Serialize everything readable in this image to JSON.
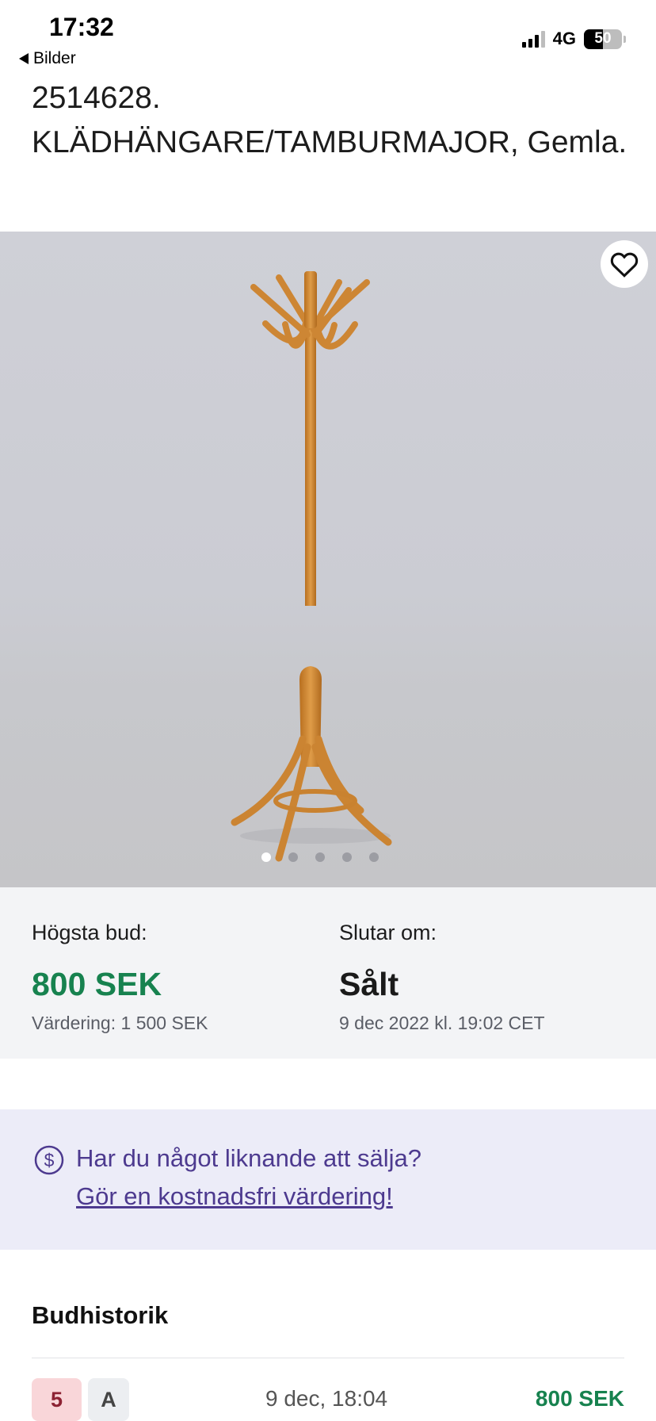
{
  "status_bar": {
    "time": "17:32",
    "back_label": "Bilder",
    "network": "4G",
    "battery": "50"
  },
  "listing": {
    "title": "2514628. KLÄDHÄNGARE/TAMBURMAJOR, Gemla."
  },
  "gallery": {
    "image_count": 5,
    "active_index": 0,
    "favorite_icon": "heart-icon"
  },
  "bidding": {
    "highest_bid_label": "Högsta bud:",
    "highest_bid_value": "800 SEK",
    "valuation": "Värdering: 1 500 SEK",
    "ends_label": "Slutar om:",
    "ends_value": "Sålt",
    "end_date": "9 dec 2022 kl. 19:02 CET"
  },
  "promo": {
    "icon": "dollar-circle-icon",
    "question": "Har du något liknande att sälja?",
    "link": "Gör en kostnadsfri värdering!"
  },
  "history": {
    "title": "Budhistorik",
    "rows": [
      {
        "count": "5",
        "bidder": "A",
        "date": "9 dec, 18:04",
        "amount": "800 SEK"
      }
    ]
  },
  "colors": {
    "accent_green": "#17824f",
    "promo_purple": "#4d3a8f",
    "promo_bg": "#ececf8",
    "panel_bg": "#f3f4f6"
  }
}
